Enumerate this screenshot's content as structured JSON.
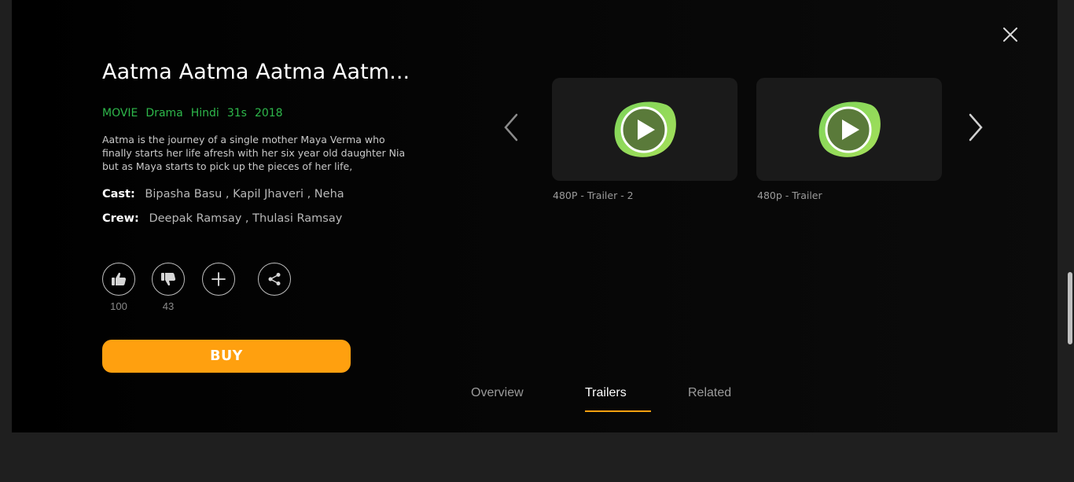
{
  "movie": {
    "title": "Aatma Aatma Aatma Aatm...",
    "meta": [
      "MOVIE",
      "Drama",
      "Hindi",
      "31s",
      "2018"
    ],
    "description": "Aatma is the journey of a single mother Maya Verma who finally starts her life afresh with her six year old daughter Nia but as Maya starts to pick up the pieces of her life,",
    "cast_label": "Cast:",
    "cast": "Bipasha Basu , Kapil Jhaveri , Neha",
    "crew_label": "Crew:",
    "crew": "Deepak Ramsay , Thulasi Ramsay"
  },
  "actions": {
    "like_count": "100",
    "dislike_count": "43",
    "buy_label": "BUY"
  },
  "trailers": [
    {
      "label": "480P - Trailer - 2"
    },
    {
      "label": "480p - Trailer"
    }
  ],
  "tabs": [
    {
      "label": "Overview",
      "active": false
    },
    {
      "label": "Trailers",
      "active": true
    },
    {
      "label": "Related",
      "active": false
    }
  ],
  "icons": {
    "close": "close-icon",
    "like": "thumbs-up-icon",
    "dislike": "thumbs-down-icon",
    "add": "plus-icon",
    "share": "share-icon",
    "prev": "chevron-left-icon",
    "next": "chevron-right-icon",
    "play": "play-icon"
  },
  "colors": {
    "accent": "#ffa00f",
    "meta_green": "#2eb84b",
    "play_green": "#8ed14a"
  }
}
